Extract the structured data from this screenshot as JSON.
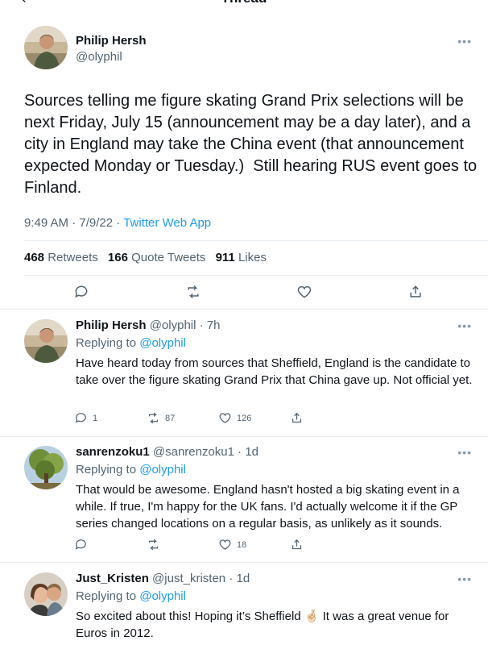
{
  "header": {
    "title": "Thread",
    "back_icon": "arrow-left-icon"
  },
  "main_tweet": {
    "name": "Philip Hersh",
    "handle": "@olyphil",
    "text": "Sources telling me figure skating Grand Prix selections will be next Friday, July 15 (announcement may be a day later), and a city in England may take the China event (that announcement expected Monday or Tuesday.)  Still hearing RUS event goes to Finland.",
    "time": "9:49 AM",
    "date": "7/9/22",
    "source": "Twitter Web App",
    "retweets_count": "468",
    "retweets_label": "Retweets",
    "quotes_count": "166",
    "quotes_label": "Quote Tweets",
    "likes_count": "911",
    "likes_label": "Likes"
  },
  "replies": [
    {
      "name": "Philip Hersh",
      "handle": "@olyphil",
      "age": "7h",
      "replying_label": "Replying to",
      "replying_to": "@olyphil",
      "text": "Have heard today from sources that Sheffield, England is the candidate to take over the figure skating Grand Prix that China gave up.  Not official yet.",
      "replies": "1",
      "retweets": "87",
      "likes": "126"
    },
    {
      "name": "sanrenzoku1",
      "handle": "@sanrenzoku1",
      "age": "1d",
      "replying_label": "Replying to",
      "replying_to": "@olyphil",
      "text": "That would be awesome. England hasn't hosted a big skating event in a while. If true, I'm happy for the UK fans. I'd actually welcome it if the GP series changed locations on a regular basis, as unlikely as it sounds.",
      "replies": "",
      "retweets": "",
      "likes": "18"
    },
    {
      "name": "Just_Kristen",
      "handle": "@just_kristen",
      "age": "1d",
      "replying_label": "Replying to",
      "replying_to": "@olyphil",
      "text": "So excited about this! Hoping it’s Sheffield 🤞🏻  It was a great venue for Euros in 2012."
    }
  ],
  "icons": [
    "reply-icon",
    "retweet-icon",
    "like-icon",
    "share-icon",
    "more-icon"
  ],
  "colors": {
    "link": "#1d9bf0",
    "muted": "#536471",
    "text": "#0f1419",
    "divider": "#e6ecf0"
  }
}
